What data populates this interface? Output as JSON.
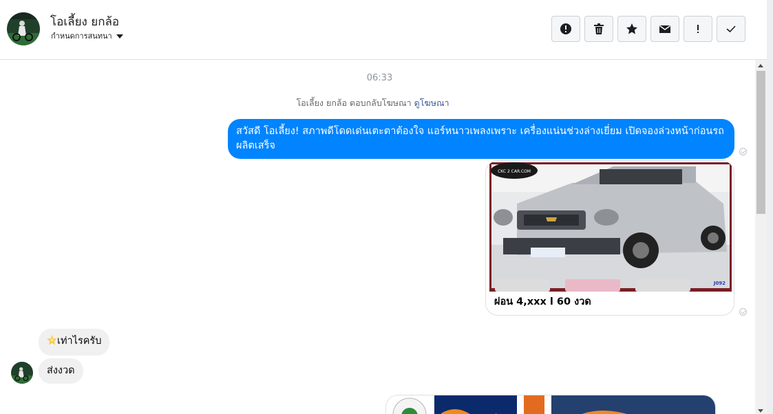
{
  "header": {
    "contact_name": "โอเลี้ยง ยกล้อ",
    "assign_label": "กำหนดการสนทนา",
    "toolbar": [
      {
        "name": "spam-button",
        "icon": "alert-circle-icon"
      },
      {
        "name": "delete-button",
        "icon": "trash-icon"
      },
      {
        "name": "star-button",
        "icon": "star-icon"
      },
      {
        "name": "mark-unread-button",
        "icon": "envelope-icon"
      },
      {
        "name": "follow-up-button",
        "icon": "exclamation-icon"
      },
      {
        "name": "mark-done-button",
        "icon": "check-icon"
      }
    ]
  },
  "chat": {
    "timestamp": "06:33",
    "ad_reply_text": "โอเลี้ยง ยกล้อ ตอบกลับโฆษณา",
    "ad_reply_link": "ดูโฆษณา",
    "outgoing_message": "สวัสดี โอเลี้ยง! สภาพดีโดดเด่นเตะตาต้องใจ แอร์หนาวเพลงเพราะ เครื่องแน่นช่วงล่างเยี่ยม เปิดจองล่วงหน้าก่อนรถผลิตเสร็จ",
    "card_caption": "ผ่อน 4,xxx l 60 งวด",
    "card_logo_text": "CKC 2 CAR.COM",
    "card_code": "J092",
    "incoming_messages": [
      {
        "icon": "sparkle-star-icon",
        "text": "เท่าไรครับ"
      },
      {
        "text": "ส่งงวด"
      }
    ]
  },
  "colors": {
    "outgoing_bubble": "#0084ff",
    "incoming_bubble": "#f1f0f0",
    "link": "#385898"
  }
}
